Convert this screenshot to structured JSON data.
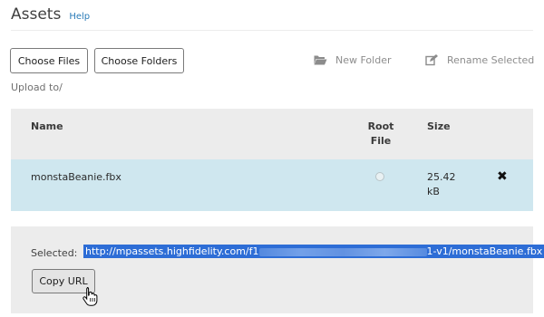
{
  "header": {
    "title": "Assets",
    "help_link": "Help"
  },
  "toolbar": {
    "choose_files": "Choose Files",
    "choose_folders": "Choose Folders",
    "new_folder": "New Folder",
    "new_folder_icon": "folder-open-icon",
    "rename_selected": "Rename Selected",
    "rename_icon": "edit-icon"
  },
  "upload": {
    "label": "Upload to",
    "path": "/"
  },
  "table": {
    "columns": {
      "name": "Name",
      "root_file": "Root\nFile",
      "size": "Size"
    },
    "rows": [
      {
        "name": "monstaBeanie.fbx",
        "size": "25.42 kB",
        "root_file": false
      }
    ]
  },
  "selection": {
    "label": "Selected:",
    "url_prefix": "http://mpassets.highfidelity.com/f1",
    "url_suffix": "1-v1/monstaBeanie.fbx",
    "copy_button": "Copy URL"
  },
  "colors": {
    "accent_link": "#2a7bb8",
    "selected_row": "#cfe7ef",
    "url_highlight": "#2d6dd6"
  }
}
